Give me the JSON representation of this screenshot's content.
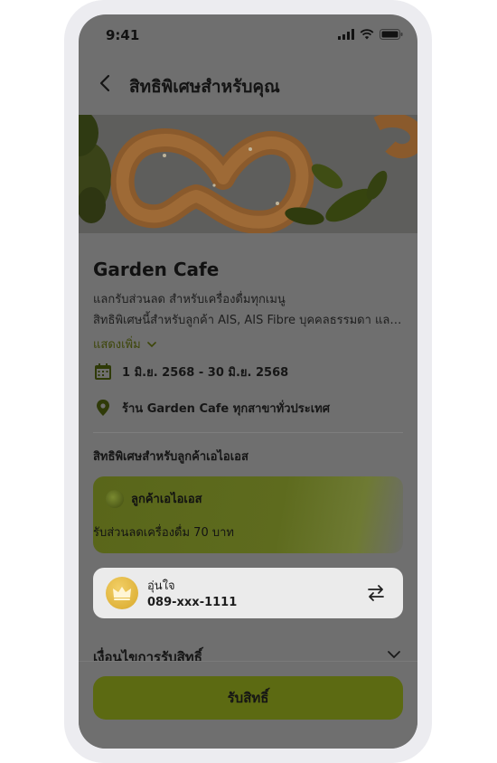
{
  "status_bar": {
    "time": "9:41"
  },
  "header": {
    "title": "สิทธิพิเศษสำหรับคุณ"
  },
  "offer": {
    "title": "Garden Cafe",
    "subtitle": "แลกรับส่วนลด สำหรับเครื่องดื่มทุกเมนู",
    "description": "สิทธิพิเศษนี้สำหรับลูกค้า AIS, AIS Fibre บุคคลธรรมดา และนิติบุคคล",
    "show_more_label": "แสดงเพิ่ม",
    "date_range": "1 มิ.ย. 2568 - 30 มิ.ย. 2568",
    "location": "ร้าน Garden Cafe ทุกสาขาทั่วประเทศ"
  },
  "section": {
    "label": "สิทธิพิเศษสำหรับลูกค้าเอไอเอส"
  },
  "benefit": {
    "tier": "ลูกค้าเอไอเอส",
    "text": "รับส่วนลดเครื่องดื่ม 70 บาท"
  },
  "account": {
    "name": "อุ่นใจ",
    "phone": "089-xxx-1111"
  },
  "conditions": {
    "label": "เงื่อนไขการรับสิทธิ์"
  },
  "cta": {
    "label": "รับสิทธิ์"
  },
  "icons": {
    "back": "chevron-left-icon",
    "calendar": "calendar-icon",
    "location": "location-pin-icon",
    "crown": "crown-icon",
    "swap": "swap-arrows-icon",
    "chevron_down": "chevron-down-icon"
  },
  "colors": {
    "overlay_gray": "#6f6f6f",
    "accent_olive": "#5c6a12",
    "crown_gold": "#e2b53e",
    "icon_dark_green": "#2f3a08"
  }
}
